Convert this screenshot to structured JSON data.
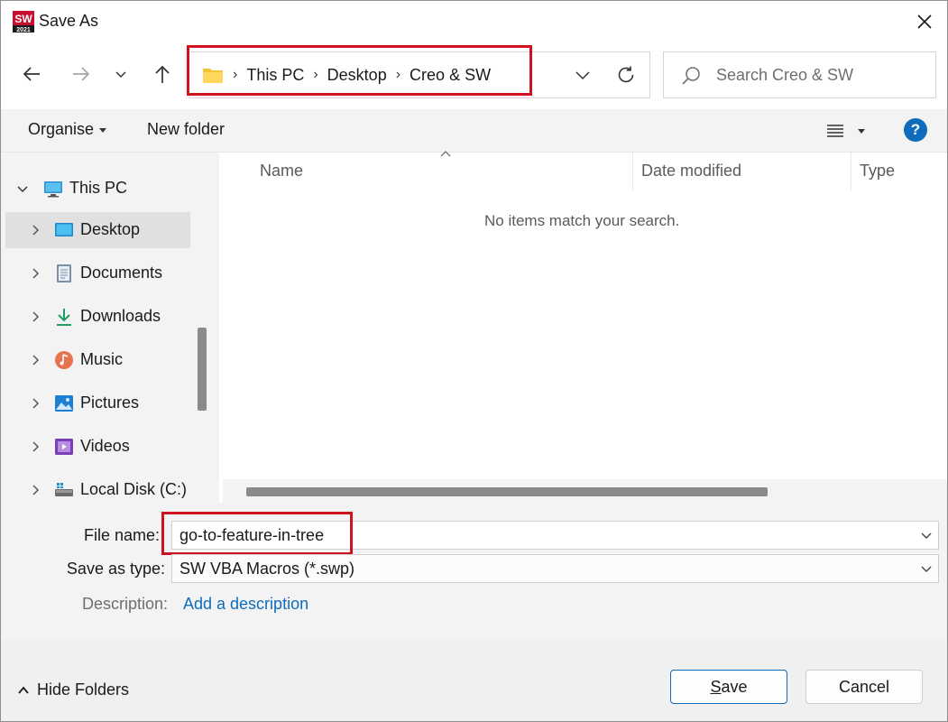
{
  "window": {
    "title": "Save As",
    "app_icon": "solidworks-2021-icon",
    "app_icon_text": "2021"
  },
  "nav": {
    "back_icon": "arrow-left-icon",
    "forward_icon": "arrow-right-icon",
    "recent_icon": "chevron-down-icon",
    "up_icon": "arrow-up-icon",
    "breadcrumbs": [
      "This PC",
      "Desktop",
      "Creo & SW"
    ],
    "folder_icon": "folder-icon",
    "refresh_icon": "refresh-icon"
  },
  "search": {
    "placeholder": "Search Creo & SW",
    "value": ""
  },
  "toolbar": {
    "organise_label": "Organise",
    "new_folder_label": "New folder",
    "view_icon": "list-view-icon",
    "help_label": "?"
  },
  "nav_tree": {
    "root": {
      "label": "This PC",
      "icon": "pc-icon"
    },
    "items": [
      {
        "label": "Desktop",
        "icon": "desktop-icon",
        "selected": true
      },
      {
        "label": "Documents",
        "icon": "documents-icon"
      },
      {
        "label": "Downloads",
        "icon": "downloads-icon"
      },
      {
        "label": "Music",
        "icon": "music-icon"
      },
      {
        "label": "Pictures",
        "icon": "pictures-icon"
      },
      {
        "label": "Videos",
        "icon": "videos-icon"
      },
      {
        "label": "Local Disk (C:)",
        "icon": "drive-icon"
      }
    ]
  },
  "file_list": {
    "columns": [
      "Name",
      "Date modified",
      "Type"
    ],
    "empty_message": "No items match your search."
  },
  "fields": {
    "file_name_label": "File name:",
    "file_name_value": "go-to-feature-in-tree",
    "save_as_type_label": "Save as type:",
    "save_as_type_value": "SW VBA Macros (*.swp)",
    "description_label": "Description:",
    "description_link": "Add a description"
  },
  "footer": {
    "hide_folders_label": "Hide Folders",
    "save_label": "Save",
    "cancel_label": "Cancel"
  },
  "colors": {
    "accent": "#0f6cbd",
    "highlight_red": "#d01120"
  }
}
